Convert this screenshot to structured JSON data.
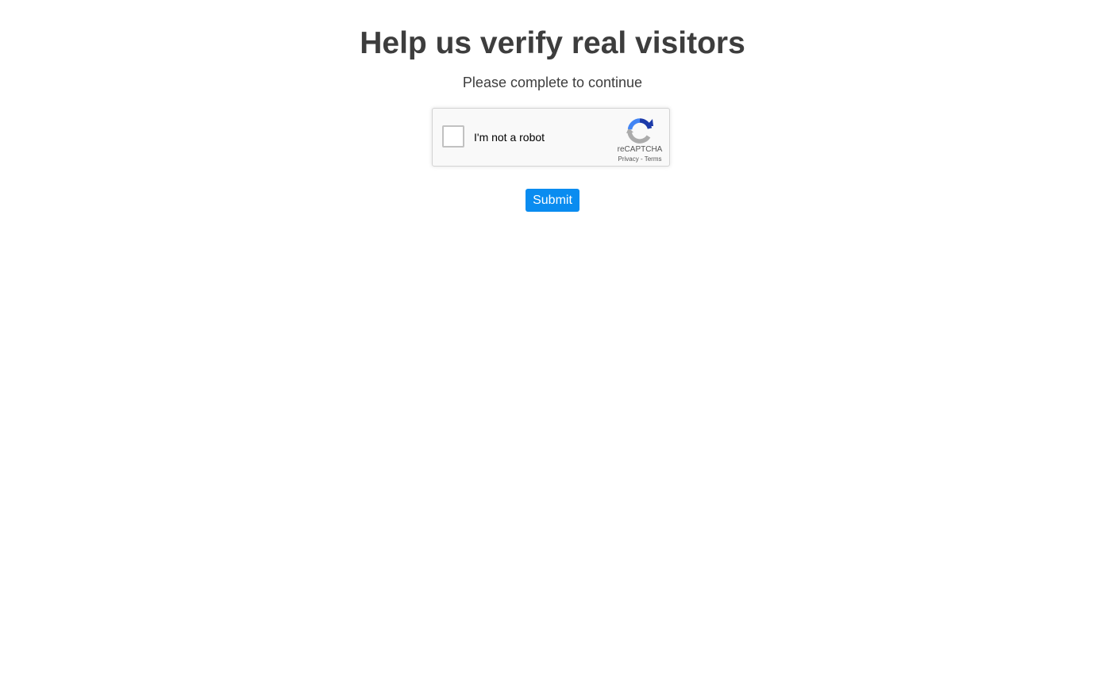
{
  "page": {
    "title": "Help us verify real visitors",
    "subtitle": "Please complete to continue"
  },
  "recaptcha": {
    "checkbox_label": "I'm not a robot",
    "checked": false,
    "brand": "reCAPTCHA",
    "privacy_link": "Privacy",
    "link_separator": " - ",
    "terms_link": "Terms",
    "icon": "recaptcha-logo-icon"
  },
  "form": {
    "submit_label": "Submit"
  },
  "colors": {
    "text": "#3d3d3d",
    "submit_button": "#0a8cf0",
    "recaptcha_blue": "#1c3aa9",
    "recaptcha_lightblue": "#4285f4",
    "recaptcha_gray": "#ababab"
  }
}
